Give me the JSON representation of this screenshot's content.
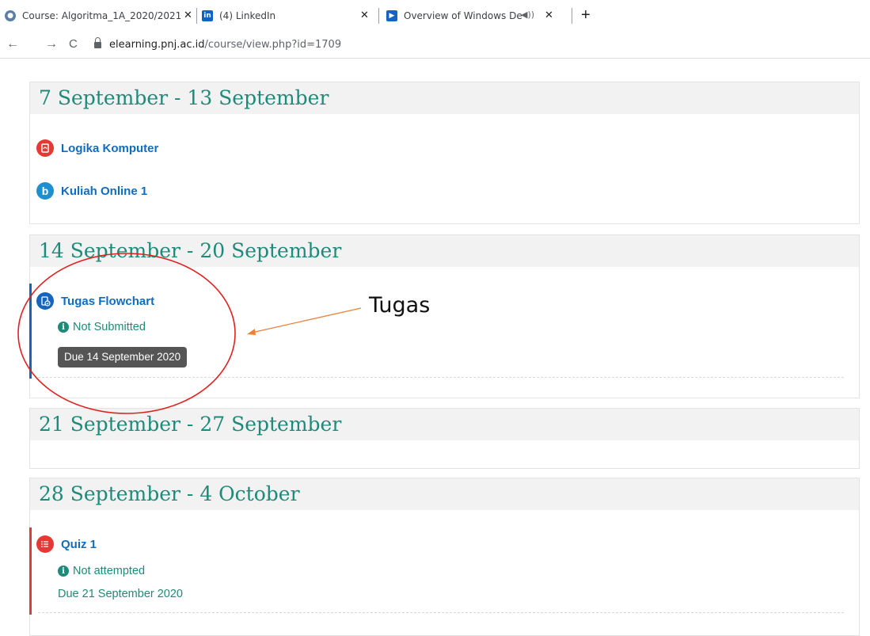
{
  "browser": {
    "tabs": [
      {
        "title": "Course: Algoritma_1A_2020/2021",
        "close": "✕"
      },
      {
        "title": "(4) LinkedIn",
        "close": "✕"
      },
      {
        "title": "Overview of Windows Defen",
        "close": "✕"
      }
    ],
    "new_tab": "+",
    "nav": {
      "back": "←",
      "forward": "→",
      "reload": "C"
    },
    "url_host": "elearning.pnj.ac.id",
    "url_path": "/course/view.php?id=1709"
  },
  "sections": [
    {
      "title": "7 September - 13 September",
      "activities": [
        {
          "label": "Logika Komputer",
          "icon": "pdf-icon",
          "color": "#e53935"
        },
        {
          "label": "Kuliah Online 1",
          "icon": "bigbluebutton-icon",
          "color": "#1e90d0"
        }
      ]
    },
    {
      "title": "14 September - 20 September",
      "activities": [
        {
          "label": "Tugas Flowchart",
          "icon": "assignment-icon",
          "color": "#1565c0",
          "status": "Not Submitted",
          "due": "Due 14 September 2020"
        }
      ]
    },
    {
      "title": "21 September - 27 September",
      "activities": []
    },
    {
      "title": "28 September - 4 October",
      "activities": [
        {
          "label": "Quiz 1",
          "icon": "quiz-icon",
          "color": "#e53935",
          "status": "Not attempted",
          "due": "Due 21 September 2020"
        }
      ]
    }
  ],
  "annotation": {
    "label": "Tugas",
    "ellipse_color": "#e02020",
    "arrow_color": "#e8823a"
  },
  "colors": {
    "heading": "#1e8a79",
    "link": "#0f6cbf",
    "assign_bar": "#1565c0",
    "quiz_bar": "#e53935"
  }
}
